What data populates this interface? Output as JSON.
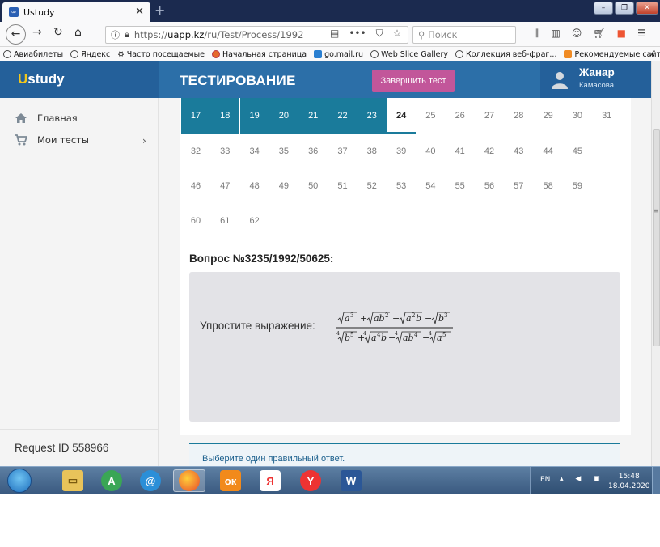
{
  "browser": {
    "tab_title": "Ustudy",
    "tab_favicon": "∞",
    "url_prefix": "https://",
    "url_host": "uapp.kz",
    "url_path": "/ru/Test/Process/1992",
    "search_placeholder": "Поиск",
    "bookmarks": [
      "Авиабилеты",
      "Яндекс",
      "Часто посещаемые",
      "Начальная страница",
      "go.mail.ru",
      "Web Slice Gallery",
      "Коллекция веб-фраг...",
      "Рекомендуемые сайты"
    ]
  },
  "header": {
    "logo_u": "U",
    "logo_rest": "study",
    "title": "ТЕСТИРОВАНИЕ",
    "finish_button": "Завершить тест",
    "user_name": "Жанар",
    "user_surname": "Камасова"
  },
  "sidebar": {
    "items": [
      {
        "label": "Главная",
        "icon": "home-icon"
      },
      {
        "label": "Мои тесты",
        "icon": "cart-icon"
      }
    ],
    "request_id": "Request ID 558966"
  },
  "questions": {
    "answered": [
      "17",
      "18",
      "19",
      "20",
      "21",
      "22",
      "23"
    ],
    "current": "24",
    "row1": [
      "17",
      "18",
      "19",
      "20",
      "21",
      "22",
      "23",
      "24",
      "25",
      "26",
      "27",
      "28",
      "29",
      "30",
      "31"
    ],
    "row2": [
      "32",
      "33",
      "34",
      "35",
      "36",
      "37",
      "38",
      "39",
      "40",
      "41",
      "42",
      "43",
      "44",
      "45"
    ],
    "row3": [
      "46",
      "47",
      "48",
      "49",
      "50",
      "51",
      "52",
      "53",
      "54",
      "55",
      "56",
      "57",
      "58",
      "59"
    ],
    "row4": [
      "60",
      "61",
      "62"
    ]
  },
  "question": {
    "title": "Вопрос №3235/1992/50625:",
    "text": "Упростите выражение:",
    "answer_prompt": "Выберите один правильный ответ."
  },
  "taskbar": {
    "lang": "EN",
    "time": "15:48",
    "date": "18.04.2020"
  },
  "colors": {
    "header_blue": "#2c6fa8",
    "answered_teal": "#1a7b9b",
    "finish_pink": "#c2569a",
    "logo_yellow": "#f3c71a"
  }
}
